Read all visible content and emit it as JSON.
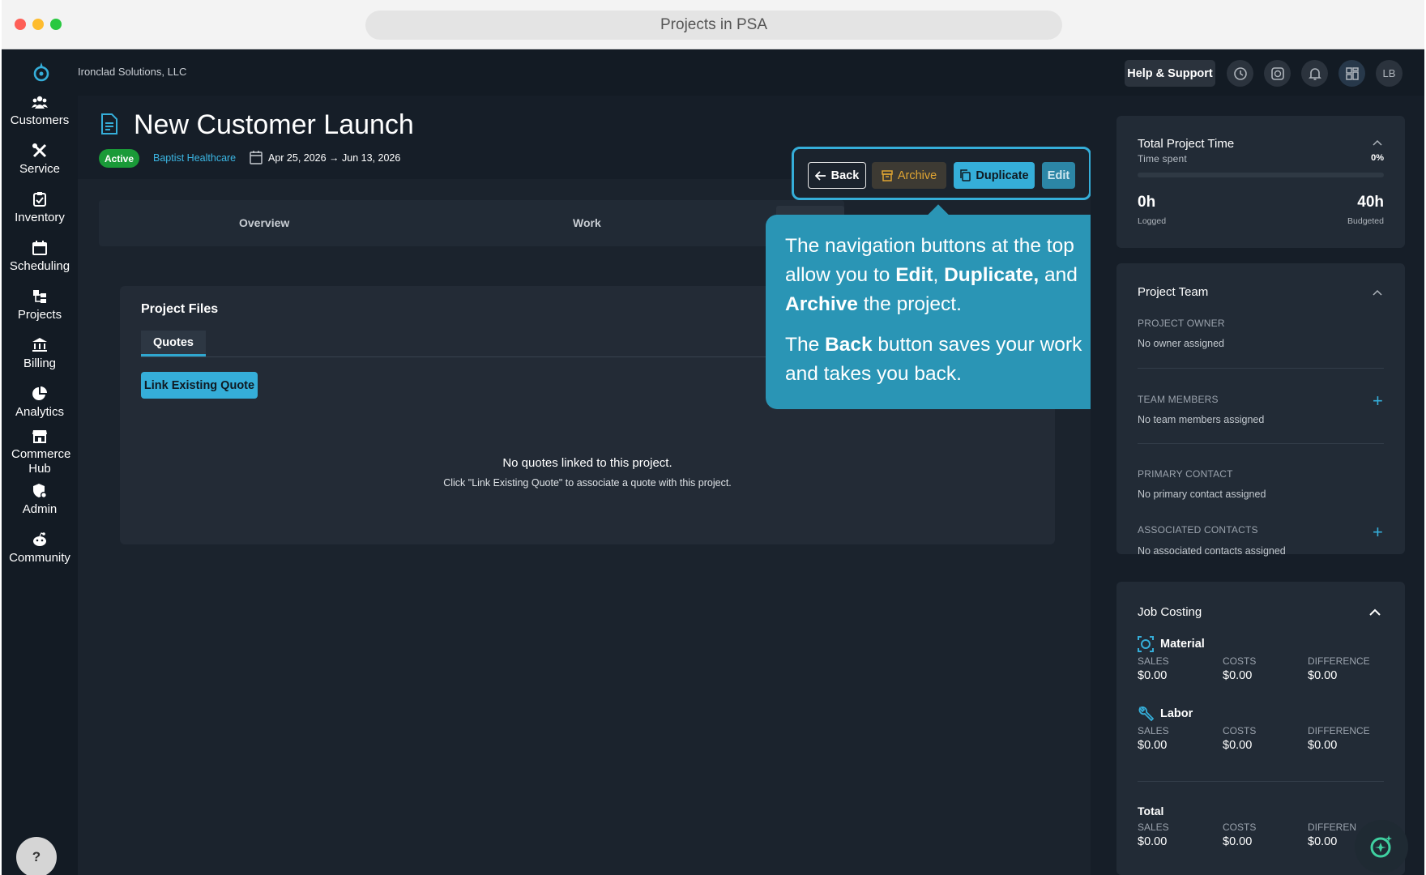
{
  "browser": {
    "title": "Projects in PSA"
  },
  "topbar": {
    "company": "Ironclad Solutions, LLC",
    "help_label": "Help & Support",
    "avatar_initials": "LB"
  },
  "nav": {
    "items": [
      {
        "label": "Customers",
        "icon": "customers-icon"
      },
      {
        "label": "Service",
        "icon": "service-icon"
      },
      {
        "label": "Inventory",
        "icon": "inventory-icon"
      },
      {
        "label": "Scheduling",
        "icon": "calendar-icon"
      },
      {
        "label": "Projects",
        "icon": "projects-icon"
      },
      {
        "label": "Billing",
        "icon": "billing-icon"
      },
      {
        "label": "Analytics",
        "icon": "analytics-icon"
      },
      {
        "label": "Commerce Hub",
        "icon": "commerce-icon"
      },
      {
        "label": "Admin",
        "icon": "admin-icon"
      },
      {
        "label": "Community",
        "icon": "community-icon"
      }
    ],
    "help_fab": "?"
  },
  "project": {
    "title": "New Customer Launch",
    "status": "Active",
    "customer": "Baptist Healthcare",
    "date_range": "Apr 25, 2026 → Jun 13, 2026"
  },
  "actions": {
    "back": "Back",
    "archive": "Archive",
    "duplicate": "Duplicate",
    "edit": "Edit"
  },
  "tabs": [
    "Overview",
    "Work"
  ],
  "files": {
    "title": "Project Files",
    "tab": "Quotes",
    "link_button": "Link Existing Quote",
    "empty_title": "No quotes linked to this project.",
    "empty_hint": "Click \"Link Existing Quote\" to associate a quote with this project."
  },
  "tooltip": {
    "p1_a": "The navigation buttons at the top allow you to ",
    "p1_edit": "Edit",
    "p1_comma": ", ",
    "p1_dup": "Duplicate,",
    "p1_and": " and ",
    "p1_archive": "Archive",
    "p1_end": " the project.",
    "p2_a": "The ",
    "p2_back": "Back",
    "p2_end": " button saves your work and takes you back."
  },
  "time_card": {
    "title": "Total Project Time",
    "subtitle": "Time spent",
    "percent": "0%",
    "logged_value": "0h",
    "logged_label": "Logged",
    "budget_value": "40h",
    "budget_label": "Budgeted"
  },
  "team_card": {
    "title": "Project Team",
    "owner_label": "PROJECT OWNER",
    "owner_value": "No owner assigned",
    "members_label": "TEAM MEMBERS",
    "members_value": "No team members assigned",
    "primary_label": "PRIMARY CONTACT",
    "primary_value": "No primary contact assigned",
    "assoc_label": "ASSOCIATED CONTACTS",
    "assoc_value": "No associated contacts assigned"
  },
  "costing_card": {
    "title": "Job Costing",
    "sales_label": "SALES",
    "costs_label": "COSTS",
    "diff_label": "DIFFERENCE",
    "diff_label_cut": "DIFFEREN",
    "material": {
      "name": "Material",
      "sales": "$0.00",
      "costs": "$0.00",
      "difference": "$0.00"
    },
    "labor": {
      "name": "Labor",
      "sales": "$0.00",
      "costs": "$0.00",
      "difference": "$0.00"
    },
    "total": {
      "name": "Total",
      "sales": "$0.00",
      "costs": "$0.00",
      "difference": "$0.00"
    }
  },
  "colors": {
    "accent": "#35aed9",
    "active_badge": "#1a9a38",
    "archive": "#e0a533",
    "tooltip": "#2a95b5"
  }
}
